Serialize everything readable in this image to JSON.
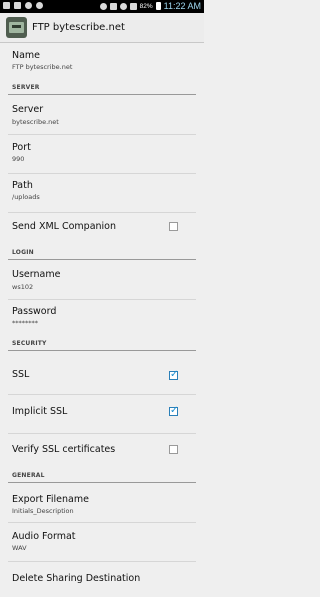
{
  "status_bar": {
    "battery": "82%",
    "time": "11:22 AM"
  },
  "app": {
    "title": "FTP bytescribe.net"
  },
  "name": {
    "title": "Name",
    "value": "FTP bytescribe.net"
  },
  "sections": {
    "server": "SERVER",
    "login": "LOGIN",
    "security": "SECURITY",
    "general": "GENERAL"
  },
  "server": {
    "title": "Server",
    "value": "bytescribe.net"
  },
  "port": {
    "title": "Port",
    "value": "990"
  },
  "path": {
    "title": "Path",
    "value": "/uploads"
  },
  "send_xml": {
    "title": "Send XML Companion",
    "checked": false
  },
  "username": {
    "title": "Username",
    "value": "ws102"
  },
  "password": {
    "title": "Password",
    "value": "********"
  },
  "ssl": {
    "title": "SSL",
    "checked": true
  },
  "implicit_ssl": {
    "title": "Implicit SSL",
    "checked": true
  },
  "verify_ssl": {
    "title": "Verify SSL certificates",
    "checked": false
  },
  "export_filename": {
    "title": "Export Filename",
    "value": "Initials_Description"
  },
  "audio_format": {
    "title": "Audio Format",
    "value": "WAV"
  },
  "delete": {
    "title": "Delete Sharing Destination"
  },
  "colors": {
    "accent": "#1e8fd0",
    "background": "#efefef"
  }
}
